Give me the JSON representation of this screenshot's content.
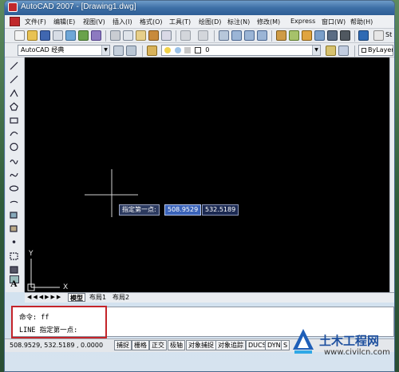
{
  "window": {
    "title": "AutoCAD 2007 - [Drawing1.dwg]"
  },
  "menu": [
    "文件(F)",
    "编辑(E)",
    "视图(V)",
    "插入(I)",
    "格式(O)",
    "工具(T)",
    "绘图(D)",
    "标注(N)",
    "修改(M)",
    "Express",
    "窗口(W)",
    "帮助(H)"
  ],
  "toolbar": {
    "workspace_value": "AutoCAD 经典",
    "layer_value": "0",
    "linetype_value": "ByLayer",
    "right_label": "St"
  },
  "tabs": [
    "模型",
    "布局1",
    "布局2"
  ],
  "ucs": {
    "y_label": "Y",
    "x_label": "X"
  },
  "dynamic_input": {
    "prompt": "指定第一点:",
    "x_value": "508.9529",
    "y_value": "532.5189"
  },
  "command": {
    "line1": "命令: ff",
    "line2": "LINE 指定第一点:"
  },
  "status": {
    "coordinates": "508.9529,  532.5189 , 0.0000",
    "buttons": [
      "捕捉",
      "栅格",
      "正交",
      "极轴",
      "对象捕捉",
      "对象追踪",
      "DUCS",
      "DYN",
      "S"
    ]
  },
  "watermark": {
    "name": "土木工程网",
    "url": "www.civilcn.com"
  },
  "colors": {
    "canvas": "#000000",
    "dyn_value": "#3a63b9",
    "highlight": "#c4242a"
  }
}
